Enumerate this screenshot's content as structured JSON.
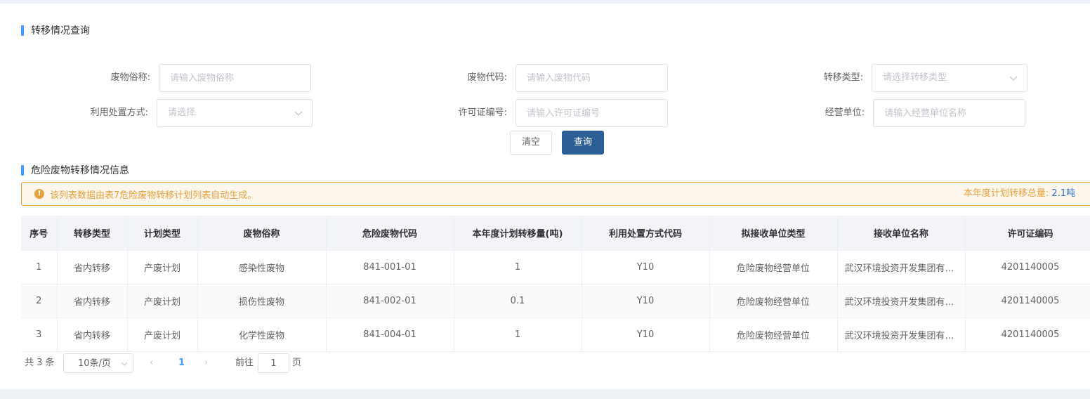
{
  "query_section": {
    "title": "转移情况查询",
    "fields": {
      "waste_name": {
        "label": "废物俗称:",
        "placeholder": "请输入废物俗称"
      },
      "waste_code": {
        "label": "废物代码:",
        "placeholder": "请输入废物代码"
      },
      "transfer_type": {
        "label": "转移类型:",
        "placeholder": "请选择转移类型"
      },
      "disposal_method": {
        "label": "利用处置方式:",
        "placeholder": "请选择"
      },
      "license_no": {
        "label": "许可证编号:",
        "placeholder": "请输入许可证编号"
      },
      "operator": {
        "label": "经营单位:",
        "placeholder": "请输入经营单位名称"
      }
    },
    "clear_label": "清空",
    "query_label": "查询"
  },
  "info_section": {
    "title": "危险废物转移情况信息",
    "alert_text": "该列表数据由表7危险废物转移计划列表自动生成。",
    "total_label": "本年度计划转移总量:",
    "total_value": "2.1吨"
  },
  "table": {
    "columns": [
      "序号",
      "转移类型",
      "计划类型",
      "废物俗称",
      "危险废物代码",
      "本年度计划转移量(吨)",
      "利用处置方式代码",
      "拟接收单位类型",
      "接收单位名称",
      "许可证编码"
    ],
    "rows": [
      [
        "1",
        "省内转移",
        "产废计划",
        "感染性废物",
        "841-001-01",
        "1",
        "Y10",
        "危险废物经营单位",
        "武汉环境投资开发集团有限公司",
        "4201140005"
      ],
      [
        "2",
        "省内转移",
        "产废计划",
        "损伤性废物",
        "841-002-01",
        "0.1",
        "Y10",
        "危险废物经营单位",
        "武汉环境投资开发集团有限公司",
        "4201140005"
      ],
      [
        "3",
        "省内转移",
        "产废计划",
        "化学性废物",
        "841-004-01",
        "1",
        "Y10",
        "危险废物经营单位",
        "武汉环境投资开发集团有限公司",
        "4201140005"
      ]
    ]
  },
  "pagination": {
    "total_text": "共 3 条",
    "page_size": "10条/页",
    "prev": "‹",
    "current_page": "1",
    "next": "›",
    "goto_label": "前往",
    "goto_value": "1",
    "page_unit": "页"
  },
  "icons": {
    "chevron": "chevron-down-icon",
    "warning": "warning-circle-icon"
  },
  "colors": {
    "accent": "#409eff",
    "primary_button": "#2d5f97",
    "warning": "#e6a23c",
    "total_value": "#2f6fd0"
  }
}
